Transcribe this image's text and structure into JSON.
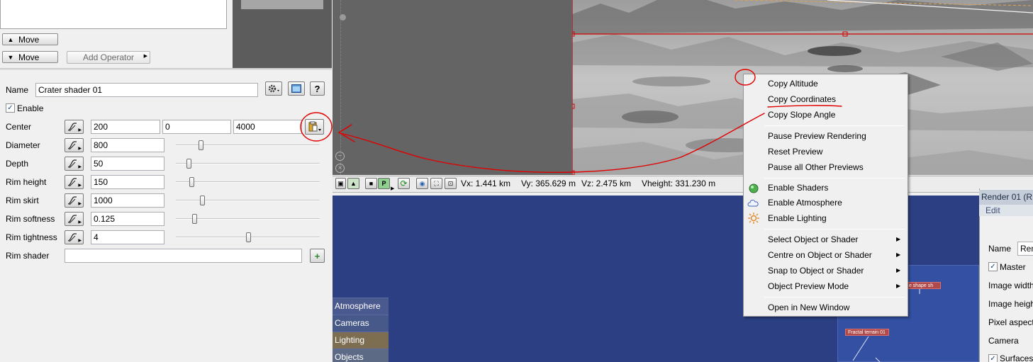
{
  "operators": {
    "move_up_label": "Move",
    "move_down_label": "Move",
    "add_operator_label": "Add Operator"
  },
  "shader": {
    "name_label": "Name",
    "name_value": "Crater shader 01",
    "enable_label": "Enable",
    "enable_checked": true,
    "rows": [
      {
        "label": "Center",
        "values": [
          "200",
          "0",
          "4000"
        ]
      },
      {
        "label": "Diameter",
        "value": "800",
        "slider": 0.17
      },
      {
        "label": "Depth",
        "value": "50",
        "slider": 0.09
      },
      {
        "label": "Rim height",
        "value": "150",
        "slider": 0.11
      },
      {
        "label": "Rim skirt",
        "value": "1000",
        "slider": 0.18
      },
      {
        "label": "Rim softness",
        "value": "0.125",
        "slider": 0.13
      },
      {
        "label": "Rim tightness",
        "value": "4",
        "slider": 0.5
      }
    ],
    "rim_shader_label": "Rim shader",
    "rim_shader_value": ""
  },
  "preview": {
    "vx": "Vx: 1.441 km",
    "vy": "Vy: 365.629 m",
    "vz": "Vz: 2.475 km",
    "vheight": "Vheight: 331.230 m",
    "toolbar_p_label": "P"
  },
  "context_menu": {
    "group1": [
      "Copy Altitude",
      "Copy Coordinates",
      "Copy Slope Angle"
    ],
    "group2": [
      "Pause Preview Rendering",
      "Reset Preview",
      "Pause all Other Previews"
    ],
    "group3": [
      {
        "label": "Enable Shaders",
        "icon": "green-sphere-icon"
      },
      {
        "label": "Enable Atmosphere",
        "icon": "cloud-icon"
      },
      {
        "label": "Enable Lighting",
        "icon": "sun-icon"
      }
    ],
    "group4": [
      "Select Object or Shader",
      "Centre on Object or Shader",
      "Snap to Object or Shader",
      "Object Preview Mode"
    ],
    "group5": [
      "Open in New Window"
    ]
  },
  "network": {
    "tabs": [
      "Atmosphere",
      "Cameras",
      "Lighting",
      "Objects"
    ],
    "active_tab": "Lighting",
    "nodes": [
      "...e shape sh",
      "Fractal terrain 01"
    ]
  },
  "render_panel": {
    "title": "Render 01   (R",
    "menu": "Edit",
    "name_label": "Name",
    "name_value": "Ren",
    "master_label": "Master",
    "labels": [
      "Image width",
      "Image heigh",
      "Pixel aspect",
      "Camera"
    ],
    "surfaces_label": "Surfaces"
  },
  "colors": {
    "accent_red": "#e00000",
    "network_bg": "#2b3f82",
    "node_red": "#b04a4a"
  }
}
